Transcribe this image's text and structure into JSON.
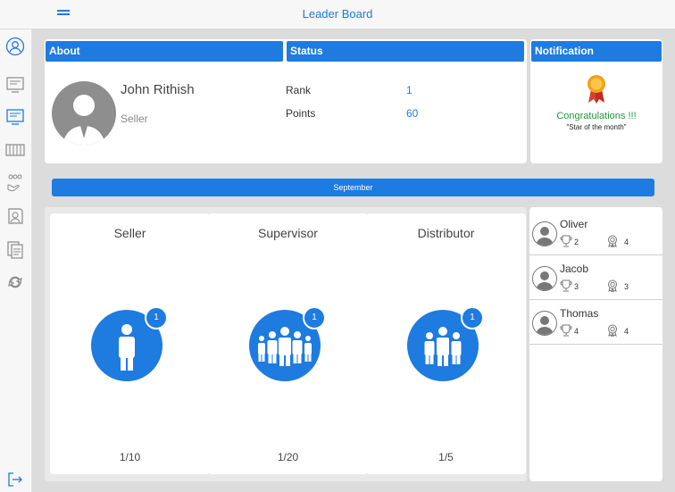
{
  "header": {
    "title": "Leader Board"
  },
  "sidebar": {
    "items": [
      {
        "icon": "user-circle-icon"
      },
      {
        "icon": "monitor-icon"
      },
      {
        "icon": "monitor-active-icon"
      },
      {
        "icon": "cabinet-icon"
      },
      {
        "icon": "team-hand-icon"
      },
      {
        "icon": "customer-icon"
      },
      {
        "icon": "documents-icon"
      },
      {
        "icon": "sync-icon"
      },
      {
        "icon": "logout-icon"
      }
    ]
  },
  "about": {
    "heading": "About",
    "name": "John Rithish",
    "role": "Seller"
  },
  "status": {
    "heading": "Status",
    "rank_label": "Rank",
    "rank_value": "1",
    "points_label": "Points",
    "points_value": "60"
  },
  "notification": {
    "heading": "Notification",
    "line1": "Congratulations !!!",
    "line2": "\"Star of the month\"",
    "icon": "award-ribbon-icon"
  },
  "month": "September",
  "roles": [
    {
      "title": "Seller",
      "badge": "1",
      "count": "1/10",
      "icon": "single-person-icon"
    },
    {
      "title": "Supervisor",
      "badge": "1",
      "count": "1/20",
      "icon": "crowd-icon"
    },
    {
      "title": "Distributor",
      "badge": "1",
      "count": "1/5",
      "icon": "group-icon"
    }
  ],
  "leaders": [
    {
      "name": "Oliver",
      "trophies": "2",
      "medals": "4"
    },
    {
      "name": "Jacob",
      "trophies": "3",
      "medals": "3"
    },
    {
      "name": "Thomas",
      "trophies": "4",
      "medals": "4"
    }
  ],
  "colors": {
    "accent": "#1e7be0",
    "success": "#1f9a3d",
    "background": "#dcdcdc"
  }
}
